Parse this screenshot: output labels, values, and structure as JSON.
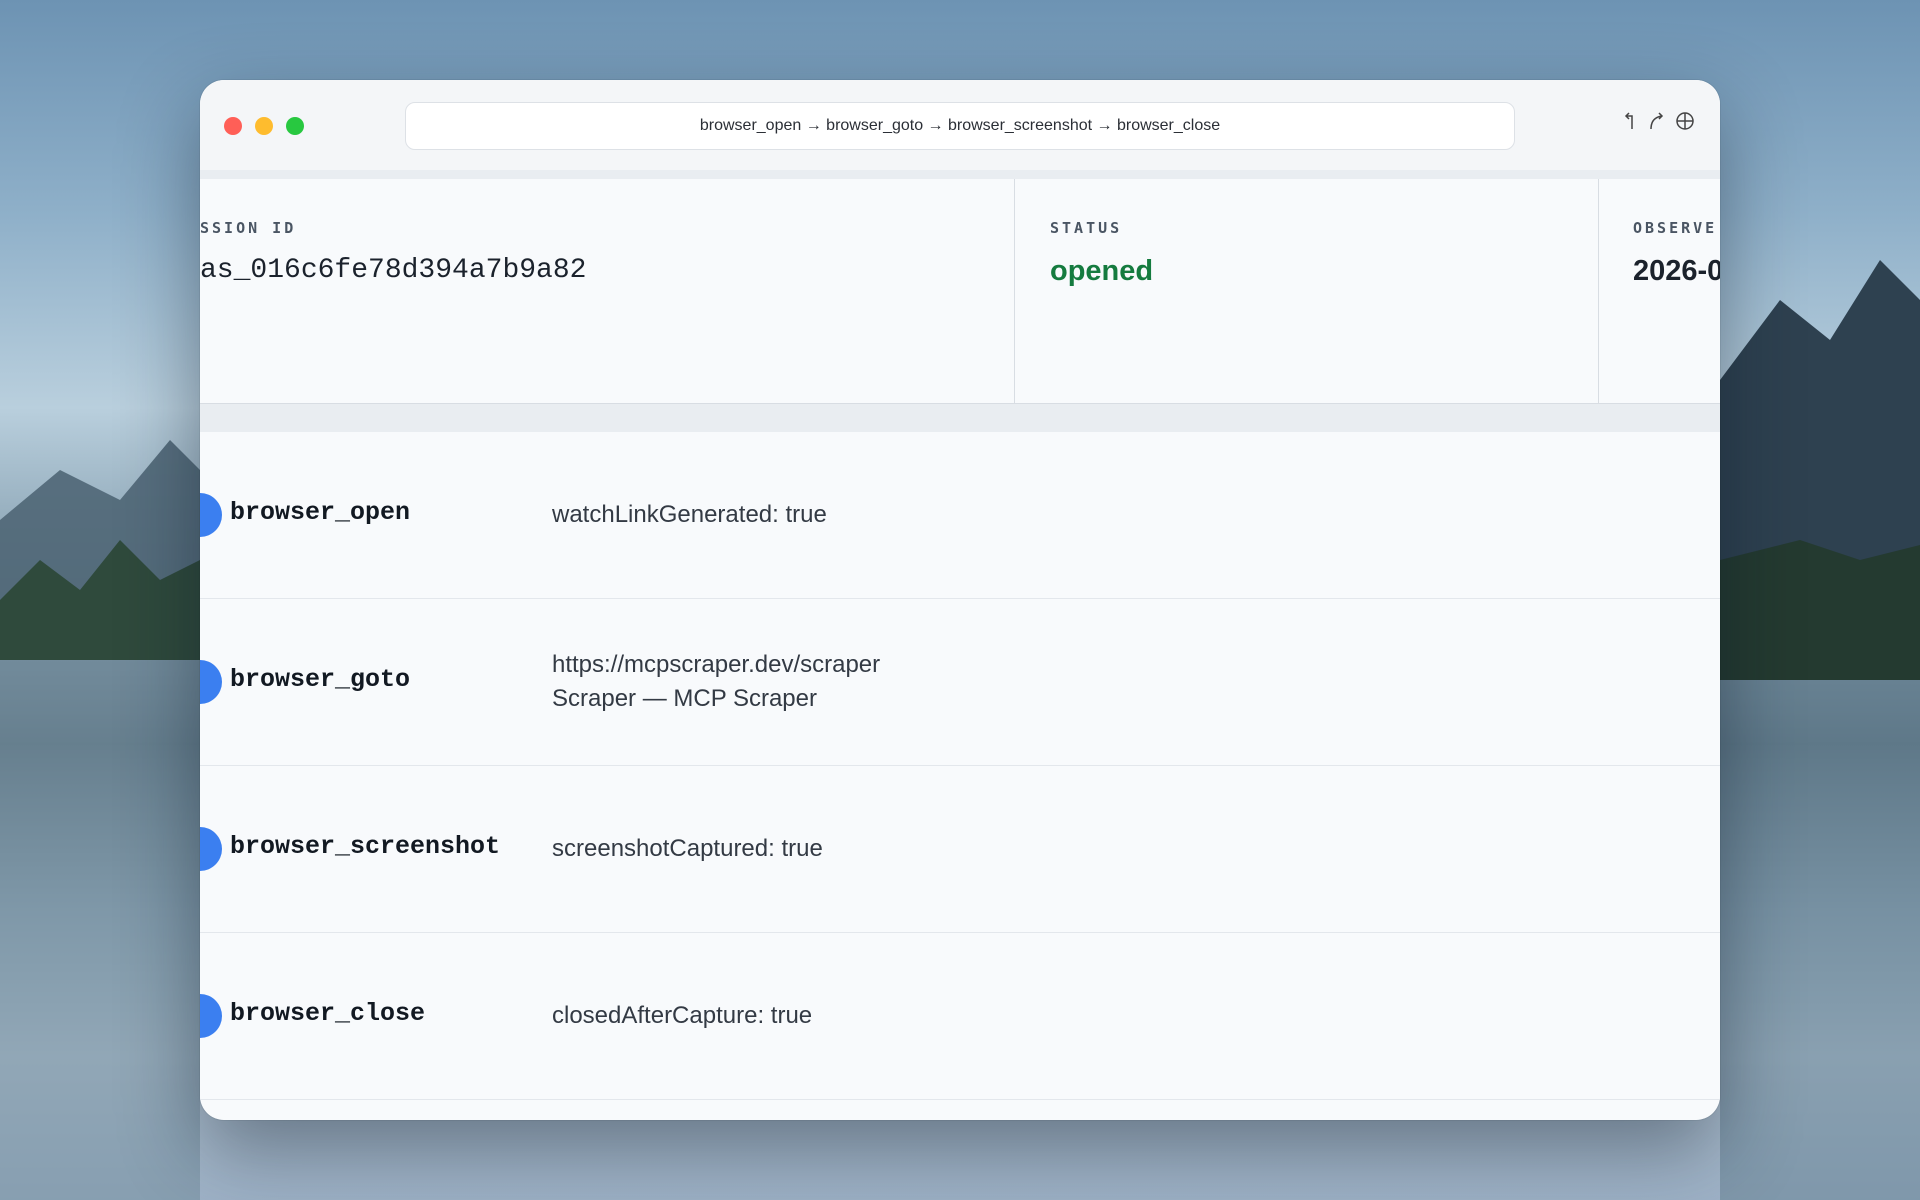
{
  "window": {
    "address": "browser_open → browser_goto → browser_screenshot → browser_close"
  },
  "cards": [
    {
      "label": "SSION ID",
      "value": "as_016c6fe78d394a7b9a82"
    },
    {
      "label": "STATUS",
      "value": "opened",
      "color": "#157b3f"
    },
    {
      "label": "OBSERVE",
      "value": "2026-0"
    }
  ],
  "steps": [
    {
      "name": "browser_open",
      "details": [
        "watchLinkGenerated: true"
      ]
    },
    {
      "name": "browser_goto",
      "details": [
        "https://mcpscraper.dev/scraper",
        "Scraper — MCP Scraper"
      ]
    },
    {
      "name": "browser_screenshot",
      "details": [
        "screenshotCaptured: true"
      ]
    },
    {
      "name": "browser_close",
      "details": [
        "closedAfterCapture: true"
      ]
    }
  ],
  "colors": {
    "accent": "#3b7ff0",
    "status_ok": "#157b3f"
  },
  "icons": [
    "back-arrow-icon",
    "forward-arrow-icon",
    "globe-icon"
  ]
}
